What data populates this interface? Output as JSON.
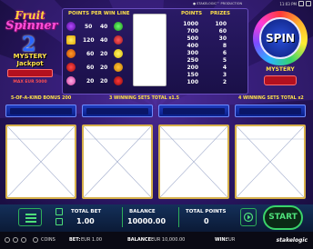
{
  "topbar": {
    "brand": "● STAKELOGIC™ PRODUCTION",
    "time": "11:03 PM"
  },
  "logo": {
    "title_line1": "Fruit",
    "title_line2": "Spinner",
    "number": "2",
    "mystery_line1": "MYSTERY",
    "mystery_line2": "Jackpot",
    "max": "MAX EUR 5000"
  },
  "paytable": {
    "points_header": "POINTS PER WIN LINE",
    "points_col": "POINTS",
    "prizes_col": "PRIZES",
    "rows": [
      {
        "pts": "50"
      },
      {
        "pts": "120"
      },
      {
        "pts": "60"
      },
      {
        "pts": "60"
      },
      {
        "pts": "20"
      }
    ],
    "rows_right": [
      {
        "pts": "40"
      },
      {
        "pts": "40"
      },
      {
        "pts": "20"
      },
      {
        "pts": "20"
      },
      {
        "pts": "20"
      }
    ],
    "prizes": [
      {
        "points": "1000",
        "prize": "100"
      },
      {
        "points": "700",
        "prize": "60"
      },
      {
        "points": "500",
        "prize": "30"
      },
      {
        "points": "400",
        "prize": "8"
      },
      {
        "points": "300",
        "prize": "6"
      },
      {
        "points": "250",
        "prize": "5"
      },
      {
        "points": "200",
        "prize": "4"
      },
      {
        "points": "150",
        "prize": "3"
      },
      {
        "points": "100",
        "prize": "2"
      }
    ]
  },
  "spin": {
    "label": "SPIN",
    "mystery": "MYSTERY"
  },
  "sets": {
    "five": "5-OF-A-KIND BONUS 200",
    "three": "3 WINNING SETS TOTAL x1.5",
    "four": "4 WINNING SETS TOTAL x2"
  },
  "bottom": {
    "total_bet_label": "TOTAL BET",
    "total_bet": "1.00",
    "balance_label": "BALANCE",
    "balance": "10000.00",
    "total_points_label": "TOTAL POINTS",
    "total_points": "0",
    "start": "START"
  },
  "footer": {
    "coins": "COINS",
    "bet_label": "BET:",
    "bet_value": "EUR 1.00",
    "balance_label": "BALANCE:",
    "balance_value": "EUR 10,000.00",
    "win_label": "WIN:",
    "win_value": "EUR",
    "brand": "stakelogic"
  },
  "colors": {
    "accent_yellow": "#ffe24a",
    "reel_blue": "#1e3bbd",
    "start_green": "#3ad36a",
    "mystery_red": "#b3101f"
  }
}
